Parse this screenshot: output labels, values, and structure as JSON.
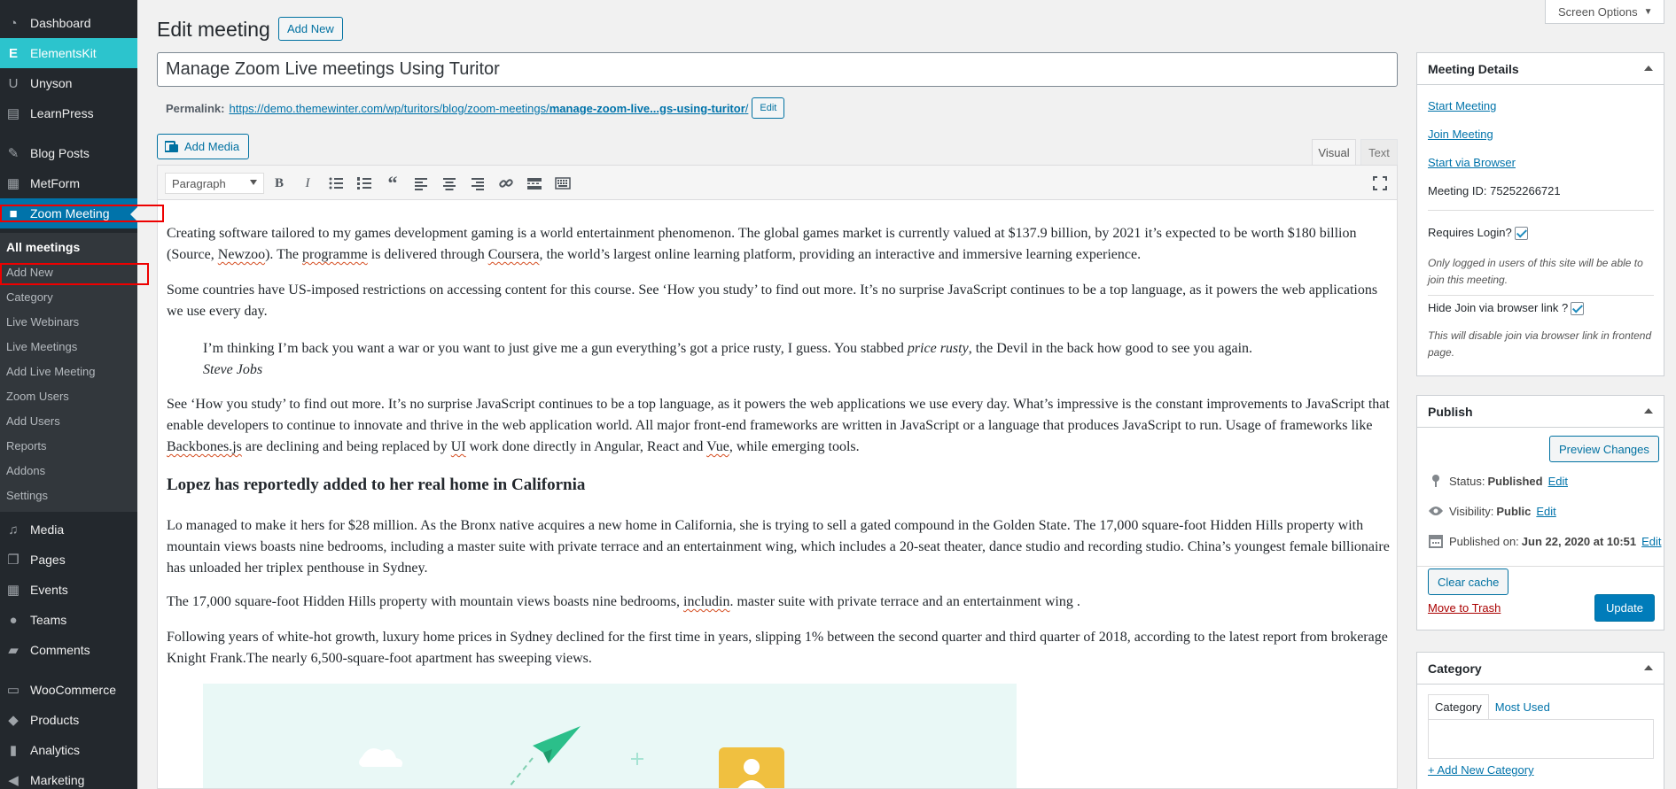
{
  "sidebar": {
    "items": [
      {
        "label": "Dashboard",
        "icon": "dashboard-icon"
      },
      {
        "label": "ElementsKit",
        "icon": "elementskit-icon"
      },
      {
        "label": "Unyson",
        "icon": "unyson-icon"
      },
      {
        "label": "LearnPress",
        "icon": "learnpress-icon"
      },
      {
        "label": "Blog Posts",
        "icon": "pin-icon"
      },
      {
        "label": "MetForm",
        "icon": "metform-icon"
      },
      {
        "label": "Zoom Meeting",
        "icon": "video-camera-icon"
      },
      {
        "label": "Media",
        "icon": "media-icon"
      },
      {
        "label": "Pages",
        "icon": "pages-icon"
      },
      {
        "label": "Events",
        "icon": "events-icon"
      },
      {
        "label": "Teams",
        "icon": "teams-icon"
      },
      {
        "label": "Comments",
        "icon": "comments-icon"
      },
      {
        "label": "WooCommerce",
        "icon": "woocommerce-icon"
      },
      {
        "label": "Products",
        "icon": "products-icon"
      },
      {
        "label": "Analytics",
        "icon": "analytics-icon"
      },
      {
        "label": "Marketing",
        "icon": "marketing-icon"
      }
    ],
    "submenu": [
      "All meetings",
      "Add New",
      "Category",
      "Live Webinars",
      "Live Meetings",
      "Add Live Meeting",
      "Zoom Users",
      "Add Users",
      "Reports",
      "Addons",
      "Settings"
    ]
  },
  "header": {
    "title": "Edit meeting",
    "add_new": "Add New",
    "screen_options": "Screen Options"
  },
  "post": {
    "title": "Manage Zoom Live meetings Using Turitor",
    "permalink_label": "Permalink:",
    "permalink_base": "https://demo.themewinter.com/wp/turitors/blog/zoom-meetings/",
    "permalink_slug": "manage-zoom-live...gs-using-turitor",
    "permalink_end": "/",
    "permalink_edit": "Edit"
  },
  "editor": {
    "add_media": "Add Media",
    "tab_visual": "Visual",
    "tab_text": "Text",
    "format": "Paragraph",
    "p1a": "Creating software tailored to my games development gaming is a world entertainment phenomenon. The global games market is currently valued at $137.9 billion, by 2021 it’s expected to be worth $180 billion (Source, ",
    "p1_newzoo": "Newzoo",
    "p1b": "). The ",
    "p1_programme": "programme",
    "p1c": " is delivered through ",
    "p1_coursera": "Coursera",
    "p1d": ", the world’s largest online learning platform, providing an interactive and immersive learning experience.",
    "p2": "Some countries have US-imposed restrictions on accessing content for this course. See ‘How you study’ to find out more. It’s no surprise JavaScript continues to be a top language, as it powers the web applications we use every day.",
    "quote_a": "I’m thinking I’m back you want a war or you want to just give me a gun everything’s got a price rusty, I guess. You stabbed ",
    "quote_em": "price rusty",
    "quote_b": ", the Devil in the back how good to see you again.",
    "quote_cite": "Steve Jobs",
    "p3a": "See ‘How you study’ to find out more. It’s no surprise JavaScript continues to be a top language, as it powers the web applications we use every day. What’s impressive is the constant improvements to JavaScript that enable developers to continue to innovate and thrive in the web application world. All major front-end frameworks are written in JavaScript or a language that produces JavaScript to run. Usage of frameworks like ",
    "p3_backbones": "Backbones.js",
    "p3b": " are declining and being replaced by ",
    "p3_ui": "UI",
    "p3c": " work done directly in Angular, React and ",
    "p3_vue": "Vue",
    "p3d": ", while emerging tools.",
    "heading": "Lopez has reportedly added to her real home in California",
    "p4": "Lo managed to make it hers for $28 million. As the Bronx native acquires a new home in California, she is trying to sell a gated compound in the Golden State. The 17,000 square-foot Hidden Hills property with mountain views boasts nine bedrooms, including a master suite with private terrace and an entertainment wing, which includes a 20-seat theater, dance studio and recording studio. China’s youngest female billionaire has unloaded her triplex penthouse in Sydney.",
    "p5a": "The 17,000 square-foot Hidden Hills property with mountain views boasts nine bedrooms, ",
    "p5_includin": "includin",
    "p5b": ". master suite with private terrace and an entertainment wing .",
    "p6": "Following years of white-hot growth, luxury home prices in Sydney declined for the first time in years, slipping 1% between the second quarter and third quarter of 2018, according to the latest report from brokerage Knight Frank.The nearly 6,500-square-foot apartment has sweeping views."
  },
  "meeting_details": {
    "title": "Meeting Details",
    "start": "Start Meeting",
    "join": "Join Meeting",
    "browser": "Start via Browser",
    "meeting_id": "Meeting ID: 75252266721",
    "requires_login": "Requires Login?",
    "requires_login_note": "Only logged in users of this site will be able to join this meeting.",
    "hide_join": "Hide Join via browser link ?",
    "hide_join_note": "This will disable join via browser link in frontend page."
  },
  "publish": {
    "title": "Publish",
    "preview": "Preview Changes",
    "status_label": "Status:",
    "status_value": "Published",
    "visibility_label": "Visibility:",
    "visibility_value": "Public",
    "published_label": "Published on:",
    "published_value": "Jun 22, 2020 at 10:51",
    "edit": "Edit",
    "clear_cache": "Clear cache",
    "trash": "Move to Trash",
    "update": "Update"
  },
  "category": {
    "title": "Category",
    "tab_category": "Category",
    "tab_most_used": "Most Used",
    "add_new": "+ Add New Category"
  },
  "colors": {
    "sidebar": "#23282d",
    "submenu": "#32373c",
    "accent": "#0073aa",
    "elementskit": "#2cc4cd",
    "highlight_box": "#ee0000",
    "plane": "#2bbf8a",
    "avatar_card": "#f0c040"
  }
}
